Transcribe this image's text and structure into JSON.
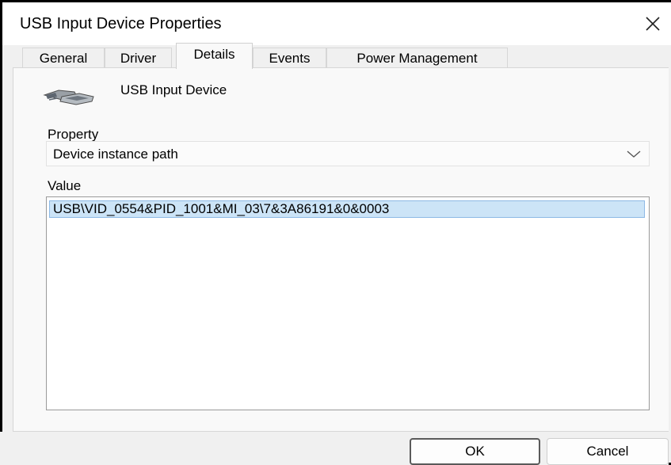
{
  "window": {
    "title": "USB Input Device Properties"
  },
  "tabs": [
    {
      "label": "General"
    },
    {
      "label": "Driver"
    },
    {
      "label": "Details"
    },
    {
      "label": "Events"
    },
    {
      "label": "Power Management"
    }
  ],
  "active_tab": "Details",
  "device": {
    "name": "USB Input Device",
    "icon": "usb-device-icon"
  },
  "property": {
    "label": "Property",
    "selected": "Device instance path"
  },
  "value": {
    "label": "Value",
    "items": [
      "USB\\VID_0554&PID_1001&MI_03\\7&3A86191&0&0003"
    ]
  },
  "buttons": {
    "ok": "OK",
    "cancel": "Cancel"
  },
  "colors": {
    "selection": "#cce4f7",
    "selection_border": "#8db9e5"
  }
}
